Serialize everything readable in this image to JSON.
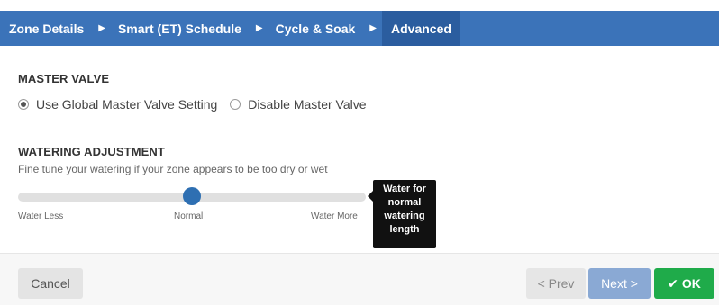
{
  "nav": {
    "steps": [
      {
        "label": "Zone Details"
      },
      {
        "label": "Smart (ET) Schedule"
      },
      {
        "label": "Cycle & Soak"
      },
      {
        "label": "Advanced"
      }
    ],
    "active_index": 3
  },
  "master_valve": {
    "title": "MASTER VALVE",
    "options": [
      {
        "label": "Use Global Master Valve Setting",
        "selected": true
      },
      {
        "label": "Disable Master Valve",
        "selected": false
      }
    ]
  },
  "watering_adjustment": {
    "title": "WATERING ADJUSTMENT",
    "description": "Fine tune your watering if your zone appears to be too dry or wet",
    "slider": {
      "value_fraction": 0.5,
      "labels": {
        "min": "Water Less",
        "mid": "Normal",
        "max": "Water More"
      }
    },
    "tooltip": [
      "Water for",
      "normal",
      "watering",
      "length"
    ]
  },
  "footer": {
    "cancel_label": "Cancel",
    "prev_label": "< Prev",
    "next_label": "Next >",
    "ok_label": "OK",
    "ok_icon": "check-icon"
  },
  "colors": {
    "nav_bg": "#3b73b9",
    "nav_active": "#2b5d9f",
    "slider_thumb": "#2e6fb2",
    "ok_green": "#1fab4a",
    "next_blue": "#8aa9d4"
  }
}
